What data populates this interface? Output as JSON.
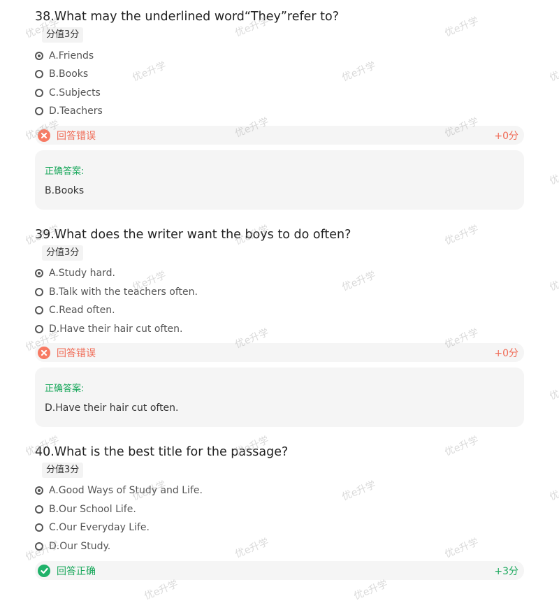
{
  "watermark": "优e升学",
  "colors": {
    "wrong": "#f06a55",
    "right": "#1aa85c"
  },
  "questions": [
    {
      "title": "38.What may the underlined word“They”refer to?",
      "score": "分值3分",
      "options": [
        {
          "label": "A.Friends",
          "selected": true
        },
        {
          "label": "B.Books",
          "selected": false
        },
        {
          "label": "C.Subjects",
          "selected": false
        },
        {
          "label": "D.Teachers",
          "selected": false
        }
      ],
      "result": {
        "status": "wrong",
        "icon": "wrong-icon",
        "text": "回答错误",
        "points": "+0分"
      },
      "answer": {
        "label": "正确答案:",
        "text": "B.Books"
      }
    },
    {
      "title": "39.What does the writer want the boys to do often?",
      "score": "分值3分",
      "options": [
        {
          "label": "A.Study hard.",
          "selected": true
        },
        {
          "label": "B.Talk with the teachers often.",
          "selected": false
        },
        {
          "label": "C.Read often.",
          "selected": false
        },
        {
          "label": "D.Have their hair cut often.",
          "selected": false
        }
      ],
      "result": {
        "status": "wrong",
        "icon": "wrong-icon",
        "text": "回答错误",
        "points": "+0分"
      },
      "answer": {
        "label": "正确答案:",
        "text": "D.Have their hair cut often."
      }
    },
    {
      "title": "40.What is the best title for the passage?",
      "score": "分值3分",
      "options": [
        {
          "label": "A.Good Ways of Study and Life.",
          "selected": true
        },
        {
          "label": "B.Our School Life.",
          "selected": false
        },
        {
          "label": "C.Our Everyday Life.",
          "selected": false
        },
        {
          "label": "D.Our Study.",
          "selected": false
        }
      ],
      "result": {
        "status": "right",
        "icon": "check-icon",
        "text": "回答正确",
        "points": "+3分"
      }
    }
  ]
}
